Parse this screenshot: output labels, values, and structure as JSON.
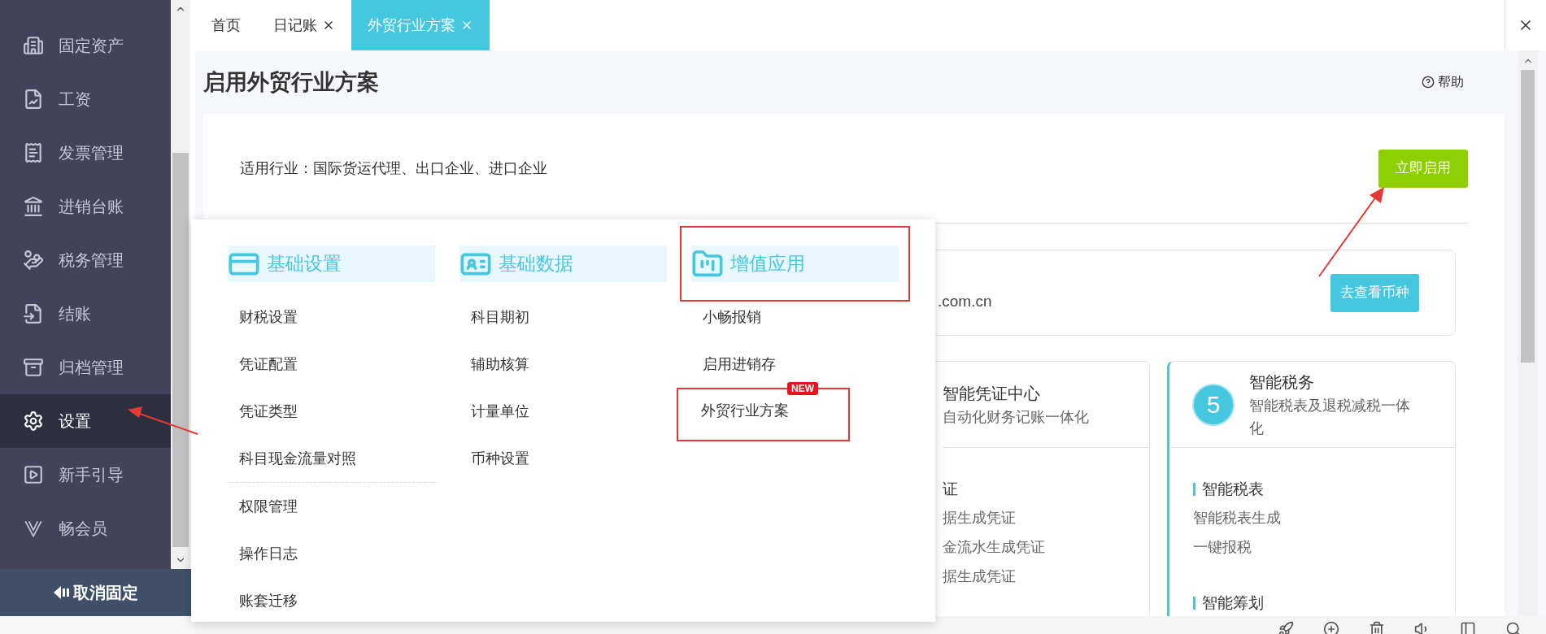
{
  "sidebar": {
    "items": [
      {
        "label": "固定资产",
        "selected": false
      },
      {
        "label": "工资",
        "selected": false
      },
      {
        "label": "发票管理",
        "selected": false
      },
      {
        "label": "进销台账",
        "selected": false
      },
      {
        "label": "税务管理",
        "selected": false
      },
      {
        "label": "结账",
        "selected": false
      },
      {
        "label": "归档管理",
        "selected": false
      },
      {
        "label": "设置",
        "selected": true
      },
      {
        "label": "新手引导",
        "selected": false
      },
      {
        "label": "畅会员",
        "selected": false
      }
    ],
    "unpin_button": "取消固定"
  },
  "tabs": [
    {
      "label": "首页",
      "closable": false,
      "selected": false
    },
    {
      "label": "日记账",
      "closable": true,
      "selected": false
    },
    {
      "label": "外贸行业方案",
      "closable": true,
      "selected": true
    }
  ],
  "page": {
    "title": "启用外贸行业方案",
    "help": "帮助",
    "industry": "适用行业：国际货运代理、出口企业、进口企业",
    "enable_button": "立即启用",
    "currency_card": {
      "text": ".com.cn",
      "button": "去查看币种"
    },
    "feature_cards": [
      {
        "title": "智能凭证中心",
        "subtitle": "自动化财务记账一体化",
        "active": false,
        "sections": [
          {
            "heading": "证",
            "items": [
              "据生成凭证",
              "金流水生成凭证",
              "据生成凭证"
            ]
          }
        ]
      },
      {
        "badge": "5",
        "title": "智能税务",
        "subtitle": "智能税表及退税减税一体化",
        "active": true,
        "sections": [
          {
            "heading": "智能税表",
            "items": [
              "智能税表生成",
              "一键报税"
            ]
          },
          {
            "heading": "智能筹划"
          }
        ]
      }
    ]
  },
  "menu": {
    "columns": [
      {
        "title": "基础设置",
        "highlighted": false,
        "groups": [
          [
            {
              "label": "财税设置",
              "highlighted": false
            },
            {
              "label": "凭证配置",
              "highlighted": false
            },
            {
              "label": "凭证类型",
              "highlighted": false
            },
            {
              "label": "科目现金流量对照",
              "highlighted": false
            }
          ],
          [
            {
              "label": "权限管理",
              "highlighted": false
            },
            {
              "label": "操作日志",
              "highlighted": false
            },
            {
              "label": "账套迁移",
              "highlighted": false
            }
          ]
        ]
      },
      {
        "title": "基础数据",
        "highlighted": false,
        "groups": [
          [
            {
              "label": "科目期初",
              "highlighted": false
            },
            {
              "label": "辅助核算",
              "highlighted": false
            },
            {
              "label": "计量单位",
              "highlighted": false
            },
            {
              "label": "币种设置",
              "highlighted": false
            }
          ]
        ]
      },
      {
        "title": "增值应用",
        "highlighted": true,
        "groups": [
          [
            {
              "label": "小畅报销",
              "highlighted": false
            },
            {
              "label": "启用进销存",
              "highlighted": false
            },
            {
              "label": "外贸行业方案",
              "badge": "NEW",
              "highlighted": true
            }
          ]
        ]
      }
    ]
  }
}
